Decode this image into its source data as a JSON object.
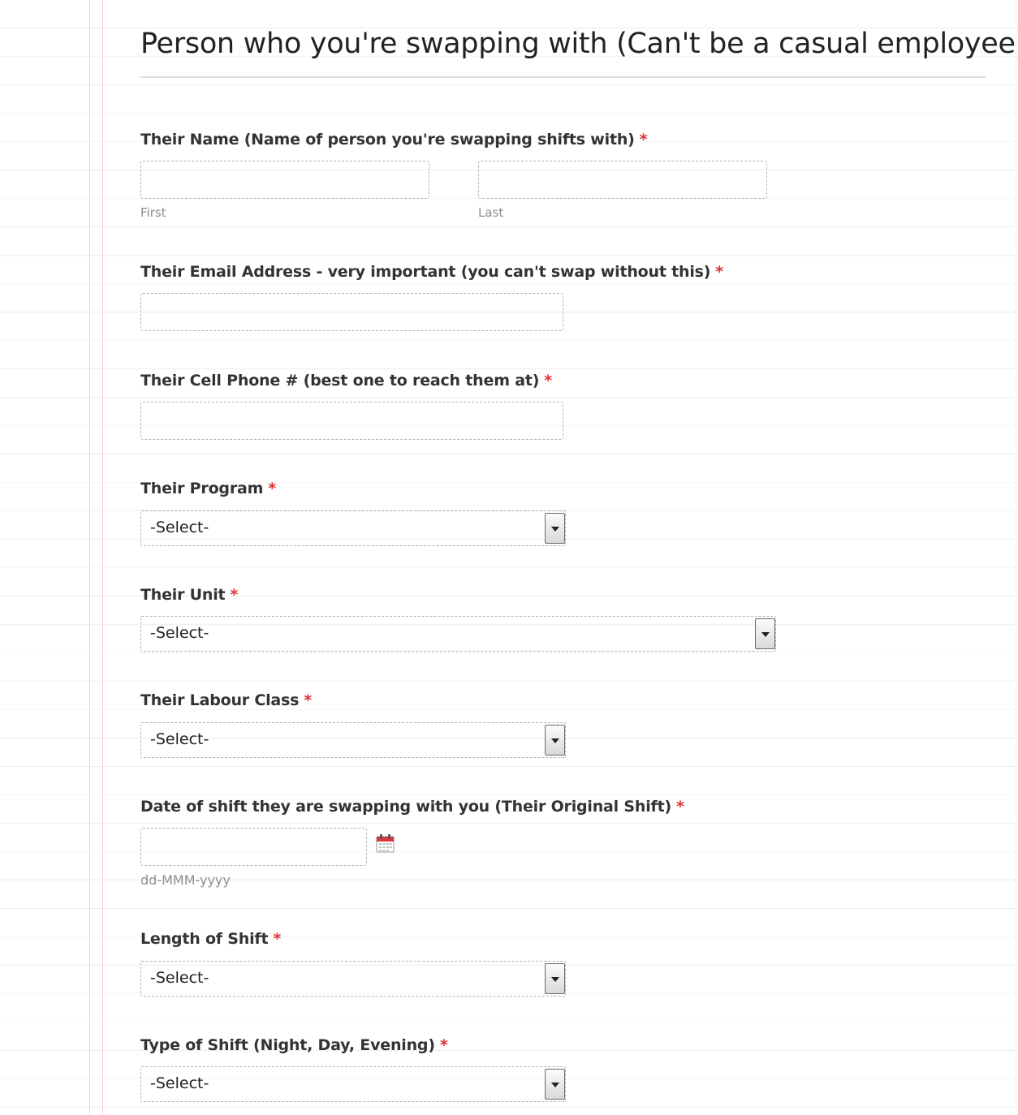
{
  "section": {
    "title": "Person who you're swapping with (Can't be a casual employee)"
  },
  "fields": {
    "name": {
      "label": "Their Name (Name of person you're swapping shifts with)",
      "required": "*",
      "first_sub": "First",
      "last_sub": "Last",
      "first_value": "",
      "last_value": ""
    },
    "email": {
      "label": "Their Email Address - very important (you can't swap without this)",
      "required": "*",
      "value": ""
    },
    "phone": {
      "label": "Their Cell Phone # (best one to reach them at)",
      "required": "*",
      "value": ""
    },
    "program": {
      "label": "Their Program",
      "required": "*",
      "selected": "-Select-"
    },
    "unit": {
      "label": "Their Unit",
      "required": "*",
      "selected": "-Select-"
    },
    "labour_class": {
      "label": "Their Labour Class",
      "required": "*",
      "selected": "-Select-"
    },
    "shift_date": {
      "label": "Date of shift they are swapping with you (Their Original Shift)",
      "required": "*",
      "format_hint": "dd-MMM-yyyy",
      "value": ""
    },
    "shift_length": {
      "label": "Length of Shift",
      "required": "*",
      "selected": "-Select-"
    },
    "shift_type": {
      "label": "Type of Shift (Night, Day, Evening)",
      "required": "*",
      "selected": "-Select-"
    }
  },
  "icons": {
    "calendar": "calendar-icon",
    "dropdown": "chevron-down-icon"
  },
  "colors": {
    "required": "#e03131",
    "margin_line": "#f2d3c5",
    "calendar_red": "#d9383a"
  }
}
